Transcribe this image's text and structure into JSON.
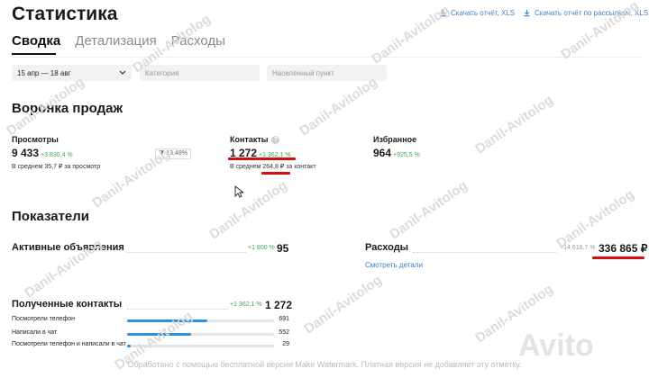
{
  "page": {
    "title": "Статистика"
  },
  "downloads": {
    "report": "Скачать отчёт, XLS",
    "mailing": "Скачать отчёт по рассылкам, XLS"
  },
  "tabs": [
    {
      "label": "Сводка",
      "active": true
    },
    {
      "label": "Детализация",
      "active": false
    },
    {
      "label": "Расходы",
      "active": false
    }
  ],
  "filters": {
    "date": "15 апр — 18 авг",
    "category_placeholder": "Категория",
    "city_placeholder": "Населённый пункт"
  },
  "funnel": {
    "title": "Воронка продаж",
    "views": {
      "label": "Просмотры",
      "value": "9 433",
      "delta": "+3 830,4 %",
      "sub": "В среднем 35,7 ₽ за просмотр"
    },
    "conversion": "13,48%",
    "contacts": {
      "label": "Контакты",
      "value": "1 272",
      "delta": "+1 362,1 %",
      "sub": "В среднем 264,8 ₽ за контакт"
    },
    "favorites": {
      "label": "Избранное",
      "value": "964",
      "delta": "+925,5 %"
    }
  },
  "indicators": {
    "title": "Показатели",
    "active_ads": {
      "label": "Активные объявления",
      "delta": "+1 800 %",
      "value": "95"
    },
    "expenses": {
      "label": "Расходы",
      "delta": "+14 616,7 %",
      "value": "336 865 ₽",
      "link": "Смотреть детали"
    }
  },
  "received": {
    "label": "Полученные контакты",
    "delta": "+1 362,1 %",
    "value": "1 272",
    "rows": [
      {
        "label": "Посмотрели телефон",
        "value": "691",
        "fraction": 0.543
      },
      {
        "label": "Написали в чат",
        "value": "552",
        "fraction": 0.434
      },
      {
        "label": "Посмотрели телефон и написали в чат",
        "value": "29",
        "fraction": 0.023
      }
    ]
  },
  "watermark": "Danil-Avitolog",
  "footer": "Обработано с помощью бесплатной версии Make Watermark. Платная версия не добавляет эту отметку.",
  "brand": "Avito",
  "colors": {
    "link": "#3b82c4",
    "positive": "#3aa655",
    "bar": "#2d8fe0",
    "highlight": "#d80e0e"
  }
}
